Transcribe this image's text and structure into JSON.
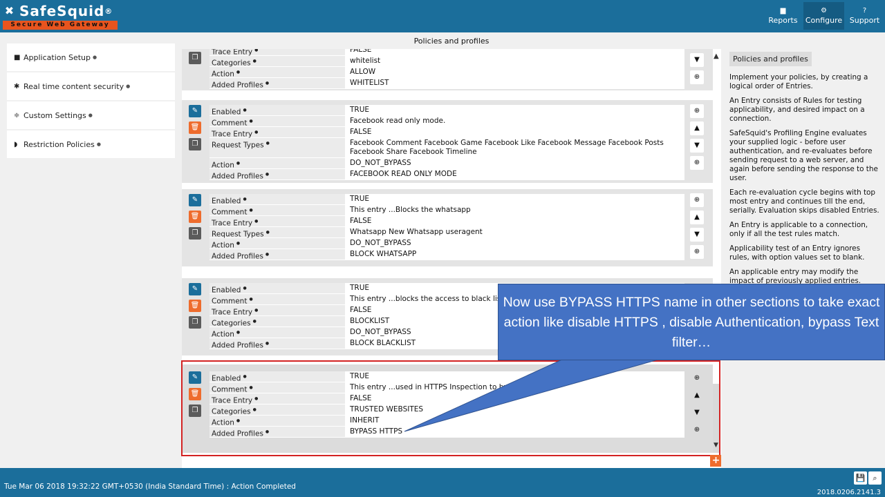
{
  "app": {
    "logo_title": "SafeSquid",
    "logo_registered": "®",
    "logo_tagline": "Secure Web Gateway"
  },
  "nav": [
    {
      "label": "Reports",
      "icon": "chart-icon"
    },
    {
      "label": "Configure",
      "icon": "gears-icon",
      "active": true
    },
    {
      "label": "Support",
      "icon": "help-icon"
    }
  ],
  "sidebar": {
    "items": [
      {
        "label": "Application Setup",
        "icon": "briefcase-icon"
      },
      {
        "label": "Real time content security",
        "icon": "bug-icon"
      },
      {
        "label": "Custom Settings",
        "icon": "sliders-icon"
      },
      {
        "label": "Restriction Policies",
        "icon": "shield-icon"
      }
    ]
  },
  "center": {
    "title": "Policies and profiles"
  },
  "entries": [
    {
      "rows": [
        {
          "label": "Trace Entry",
          "value": "FALSE"
        },
        {
          "label": "Categories",
          "value": "whitelist"
        },
        {
          "label": "Action",
          "value": "ALLOW"
        },
        {
          "label": "Added Profiles",
          "value": "WHITELIST"
        }
      ]
    },
    {
      "rows": [
        {
          "label": "Enabled",
          "value": "TRUE"
        },
        {
          "label": "Comment",
          "value": "Facebook read only mode."
        },
        {
          "label": "Trace Entry",
          "value": "FALSE"
        },
        {
          "label": "Request Types",
          "value": "Facebook Comment  Facebook Game  Facebook Like  Facebook Message  Facebook Posts  Facebook Share  Facebook Timeline"
        },
        {
          "label": "Action",
          "value": "DO_NOT_BYPASS"
        },
        {
          "label": "Added Profiles",
          "value": "FACEBOOK READ ONLY MODE"
        }
      ]
    },
    {
      "rows": [
        {
          "label": "Enabled",
          "value": "TRUE"
        },
        {
          "label": "Comment",
          "value": "This entry ...Blocks the whatsapp"
        },
        {
          "label": "Trace Entry",
          "value": "FALSE"
        },
        {
          "label": "Request Types",
          "value": "Whatsapp New  Whatsapp useragent"
        },
        {
          "label": "Action",
          "value": "DO_NOT_BYPASS"
        },
        {
          "label": "Added Profiles",
          "value": "BLOCK WHATSAPP"
        }
      ]
    },
    {
      "rows": [
        {
          "label": "Enabled",
          "value": "TRUE"
        },
        {
          "label": "Comment",
          "value": "This entry ...blocks the access to black list"
        },
        {
          "label": "Trace Entry",
          "value": "FALSE"
        },
        {
          "label": "Categories",
          "value": "BLOCKLIST"
        },
        {
          "label": "Action",
          "value": "DO_NOT_BYPASS"
        },
        {
          "label": "Added Profiles",
          "value": "BLOCK BLACKLIST"
        }
      ]
    },
    {
      "rows": [
        {
          "label": "Enabled",
          "value": "TRUE"
        },
        {
          "label": "Comment",
          "value": "This entry ...used in HTTPS Inspection to by           pection"
        },
        {
          "label": "Trace Entry",
          "value": "FALSE"
        },
        {
          "label": "Categories",
          "value": "TRUSTED WEBSITES"
        },
        {
          "label": "Action",
          "value": "INHERIT"
        },
        {
          "label": "Added Profiles",
          "value": "BYPASS HTTPS"
        }
      ]
    }
  ],
  "help": {
    "title": "Policies and profiles",
    "paragraphs": [
      "Implement your policies, by creating a logical order of Entries.",
      "An Entry consists of Rules for testing applicability, and desired impact on a connection.",
      "SafeSquid's Profiling Engine evaluates your supplied logic - before user authentication, and re-evaluates before sending request to a web server, and again before sending the response to the user.",
      "Each re-evaluation cycle begins with top most entry and continues till the end, serially. Evaluation skips disabled Entries.",
      "An Entry is applicable to a connection, only if all the test rules match.",
      "Applicability test of an Entry ignores rules, with option values set to blank.",
      "An applicable entry may modify the impact of previously applied entries."
    ]
  },
  "callout": {
    "text": "Now use BYPASS  HTTPS name in other sections to take exact action like disable HTTPS , disable Authentication, bypass Text filter…",
    "color": "#4472c4"
  },
  "status": {
    "text": "Tue Mar 06 2018 19:32:22 GMT+0530 (India Standard Time) : Action Completed",
    "version": "2018.0206.2141.3"
  },
  "colors": {
    "brand": "#1b6e9b",
    "accent": "#ee6c2d",
    "highlight": "#d32222"
  }
}
